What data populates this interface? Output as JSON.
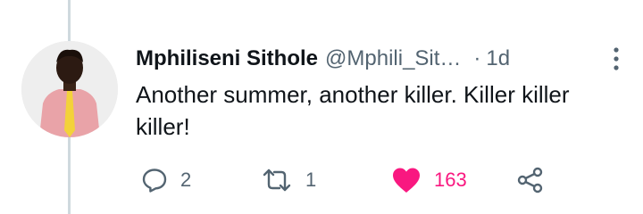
{
  "tweet": {
    "author_name": "Mphiliseni Sithole",
    "author_handle": "@Mphili_Sit…",
    "separator": "·",
    "timestamp": "1d",
    "text": "Another summer, another killer. Killer killer killer!"
  },
  "actions": {
    "reply_count": "2",
    "retweet_count": "1",
    "like_count": "163"
  },
  "icons": {
    "more": "more-vertical-icon",
    "reply": "reply-icon",
    "retweet": "retweet-icon",
    "like": "heart-filled-icon",
    "share": "share-icon"
  },
  "colors": {
    "like_active": "#f91880",
    "muted_text": "#536471",
    "primary_text": "#0f1419",
    "thread_line": "#cfd9de"
  }
}
